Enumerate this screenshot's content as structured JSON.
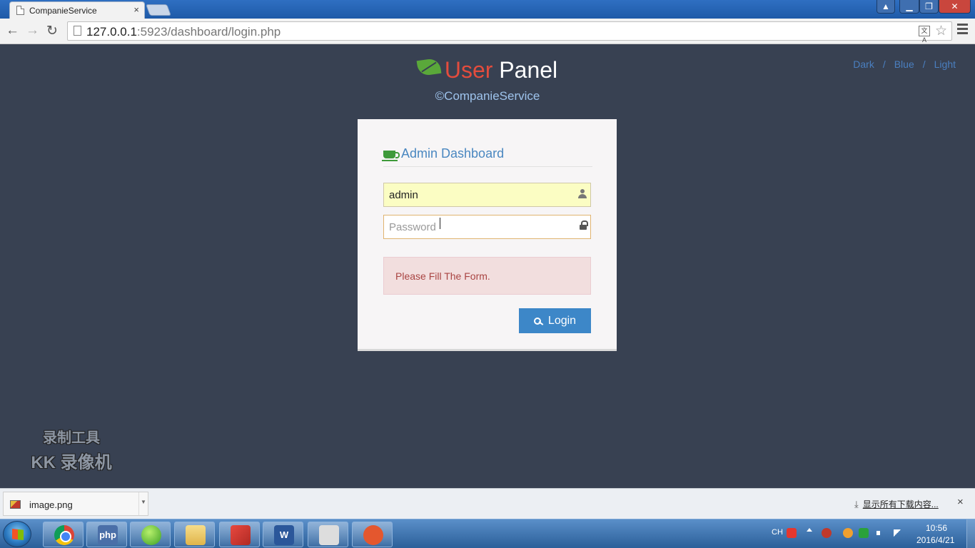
{
  "browser": {
    "tab_title": "CompanieService",
    "tab_close": "×",
    "url_host": "127.0.0.1",
    "url_rest": ":5923/dashboard/login.php",
    "translate_label": "文A",
    "window_close": "✕",
    "window_min": "▁",
    "window_max": "❐",
    "window_user": "▲"
  },
  "page": {
    "brand_user": "User",
    "brand_panel": "Panel",
    "copyright": "©CompanieService",
    "themes": [
      "Dark",
      "Blue",
      "Light"
    ],
    "theme_separator": "/"
  },
  "login": {
    "title": "Admin Dashboard",
    "username_value": "admin",
    "password_placeholder": "Password",
    "alert_text": "Please Fill The Form.",
    "button_label": "Login"
  },
  "watermark": {
    "line1": "录制工具",
    "line2": "KK 录像机"
  },
  "downloads": {
    "file_name": "image.png",
    "show_all": "显示所有下载内容...",
    "close": "×"
  },
  "taskbar": {
    "lang": "CH",
    "time": "10:56",
    "date": "2016/4/21",
    "apps": [
      {
        "name": "chrome-icon",
        "label": ""
      },
      {
        "name": "php-icon",
        "label": "php"
      },
      {
        "name": "orb-icon",
        "label": ""
      },
      {
        "name": "folder-icon",
        "label": ""
      },
      {
        "name": "book-icon",
        "label": ""
      },
      {
        "name": "word-icon",
        "label": "W"
      },
      {
        "name": "face-icon",
        "label": ""
      },
      {
        "name": "ninja-icon",
        "label": ""
      }
    ]
  },
  "colors": {
    "page_bg": "#384152",
    "brand_accent": "#e34c3d",
    "link_blue": "#4a7fc0",
    "button_blue": "#3d87c8",
    "alert_bg": "#f2dede"
  }
}
